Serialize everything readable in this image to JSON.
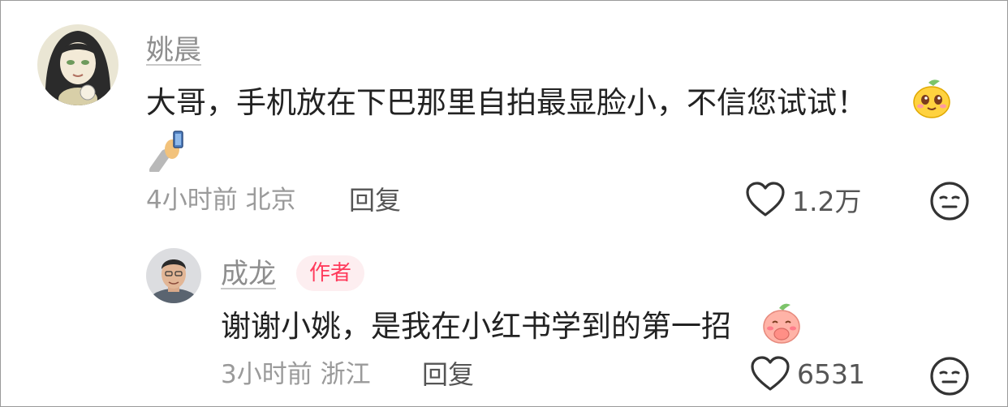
{
  "comments": [
    {
      "username": "姚晨",
      "text": "大哥，手机放在下巴那里自拍最显脸小，不信您试试！",
      "time": "4小时前",
      "location": "北京",
      "reply_label": "回复",
      "likes": "1.2万",
      "avatar_icon": "illustrated-girl-avatar",
      "inline_emojis": [
        "smug-face-sticker-icon",
        "selfie-hand-emoji"
      ]
    },
    {
      "username": "成龙",
      "badge": "作者",
      "text": "谢谢小姚，是我在小红书学到的第一招",
      "time": "3小时前",
      "location": "浙江",
      "reply_label": "回复",
      "likes": "6531",
      "avatar_icon": "man-photo-avatar",
      "inline_emojis": [
        "shy-peach-sticker-icon"
      ]
    }
  ],
  "colors": {
    "badge_text": "#ff3b5c",
    "badge_bg": "#fdeef0",
    "meta_text": "#9a9a9a",
    "username": "#8e8e8e"
  }
}
